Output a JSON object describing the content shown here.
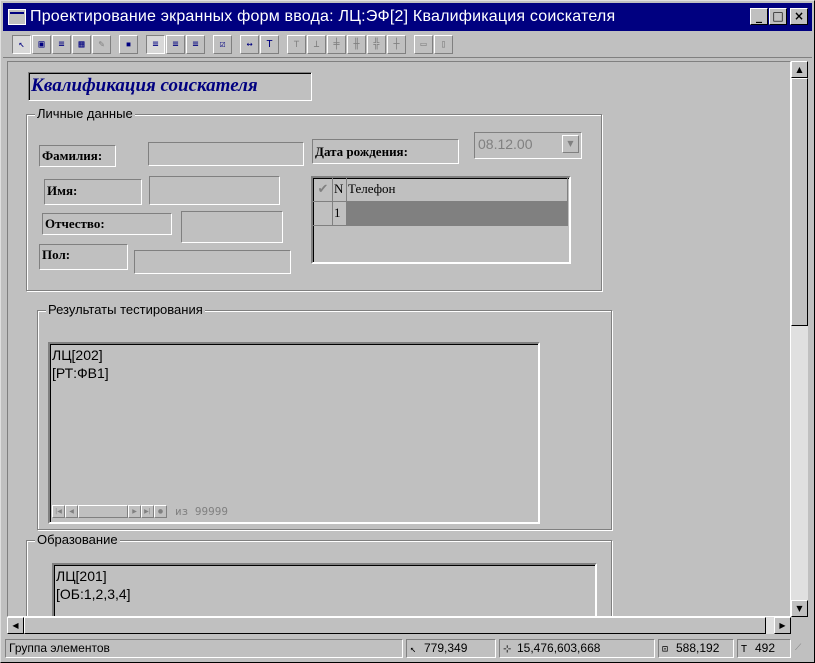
{
  "window": {
    "title": "Проектирование экранных форм ввода: ЛЦ:ЭФ[2] Квалификация соискателя",
    "minimize": "_",
    "maximize": "□",
    "close": "×"
  },
  "toolbar": {
    "groups": [
      [
        "pointer-tool",
        "select-field-tool",
        "list-tool",
        "grid-tool",
        "disabled-tool"
      ],
      [
        "save-tool"
      ],
      [
        "align-left-tool",
        "align-center-tool",
        "align-right-tool"
      ],
      [
        "check-tool"
      ],
      [
        "size-min-tool",
        "text-tool"
      ],
      [
        "align-a",
        "align-b",
        "align-c",
        "align-d",
        "align-e",
        "align-f"
      ],
      [
        "width-tool",
        "height-tool"
      ]
    ]
  },
  "form": {
    "heading": "Квалификация соискателя",
    "personal": {
      "legend": "Личные данные",
      "surname_label": "Фамилия:",
      "name_label": "Имя:",
      "patronymic_label": "Отчество:",
      "gender_label": "Пол:",
      "birthdate_label": "Дата рождения:",
      "birthdate_value": "08.12.00",
      "phones": {
        "col_n": "N",
        "col_phone": "Телефон",
        "row_n": "1"
      }
    },
    "tests": {
      "legend": "Результаты тестирования",
      "text": "ЛЦ[202]\n[РТ:ФВ1]",
      "nav_count": "из 99999"
    },
    "education": {
      "legend": "Образование",
      "text": "ЛЦ[201]\n[ОБ:1,2,3,4]"
    }
  },
  "status": {
    "mode": "Группа элементов",
    "cursor": "779,349",
    "selection": "15,476,603,668",
    "size": "588,192",
    "extra": "492"
  }
}
